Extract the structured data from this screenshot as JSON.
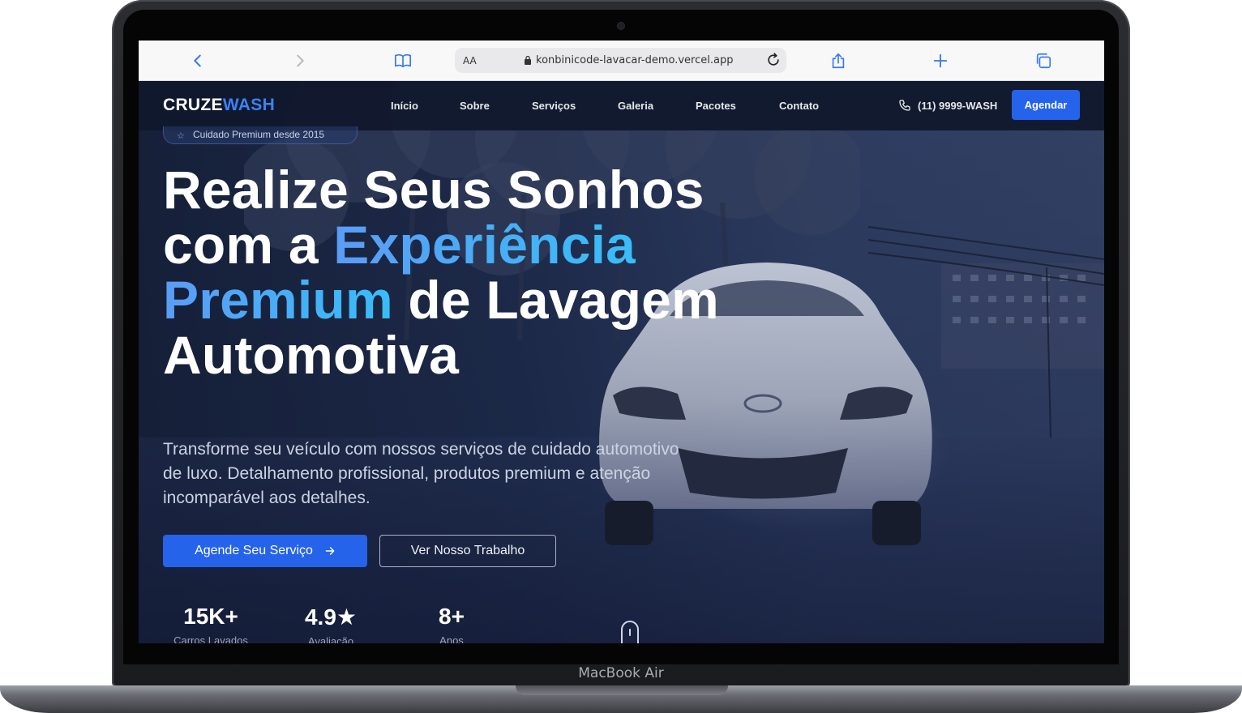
{
  "device": {
    "label": "MacBook Air"
  },
  "browser": {
    "reader_text": "AA",
    "url": "konbinicode-lavacar-demo.vercel.app",
    "icons": [
      "back-icon",
      "forward-icon",
      "bookmarks-icon",
      "lock-icon",
      "reload-icon",
      "share-icon",
      "new-tab-icon",
      "tabs-icon"
    ]
  },
  "site": {
    "brand": {
      "part1": "CRUZE",
      "part2": "WASH"
    },
    "nav": [
      {
        "label": "Início"
      },
      {
        "label": "Sobre"
      },
      {
        "label": "Serviços"
      },
      {
        "label": "Galeria"
      },
      {
        "label": "Pacotes"
      },
      {
        "label": "Contato"
      }
    ],
    "phone": "(11) 9999-WASH",
    "cta_nav": "Agendar",
    "badge": "Cuidado Premium desde 2015",
    "headline": {
      "line1": "Realize Seus Sonhos",
      "line2_a": "com a ",
      "line2_b": "Experiência",
      "line3_a": "Premium",
      "line3_b": " de Lavagem",
      "line4": "Automotiva"
    },
    "subtitle": "Transforme seu veículo com nossos serviços de cuidado automotivo de luxo. Detalhamento profissional, produtos premium e atenção incomparável aos detalhes.",
    "primary_button": "Agende Seu Serviço",
    "secondary_button": "Ver Nosso Trabalho",
    "stats": [
      {
        "value": "15K+",
        "label": "Carros Lavados"
      },
      {
        "value": "4.9★",
        "label": "Avaliação"
      },
      {
        "value": "8+",
        "label": "Anos"
      }
    ],
    "colors": {
      "accent": "#2563eb",
      "nav_bg": "#10182c",
      "gradient_start": "#5b9cf5",
      "gradient_end": "#38bdf8"
    }
  }
}
